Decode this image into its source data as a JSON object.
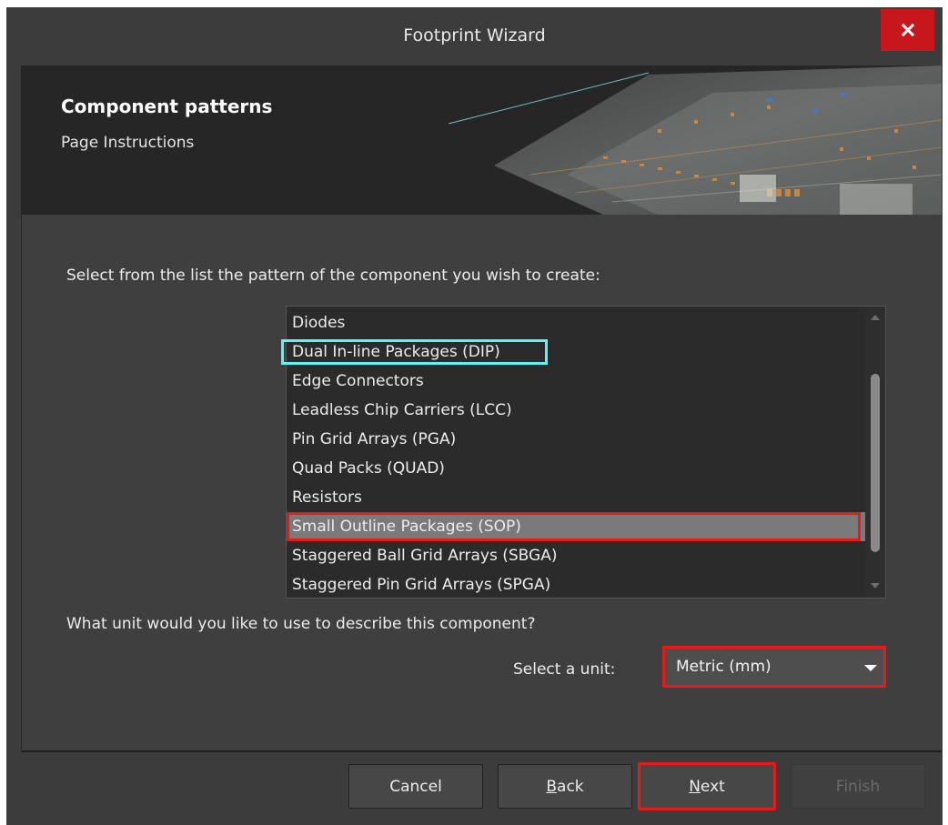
{
  "window": {
    "title": "Footprint Wizard",
    "close_icon": "close-icon"
  },
  "banner": {
    "title": "Component patterns",
    "subtitle": "Page Instructions"
  },
  "pattern_prompt": "Select from the list the pattern of the component you wish to create:",
  "patterns": {
    "items": [
      "Diodes",
      "Dual In-line Packages (DIP)",
      "Edge Connectors",
      "Leadless Chip Carriers (LCC)",
      "Pin Grid Arrays (PGA)",
      "Quad Packs (QUAD)",
      "Resistors",
      "Small Outline Packages (SOP)",
      "Staggered Ball Grid Arrays (SBGA)",
      "Staggered Pin Grid Arrays (SPGA)"
    ],
    "selected": "Small Outline Packages (SOP)"
  },
  "unit_prompt": "What unit would you like to use to describe this component?",
  "unit": {
    "label": "Select a unit:",
    "value": "Metric (mm)"
  },
  "buttons": {
    "cancel": "Cancel",
    "back_mnemonic": "B",
    "back_rest": "ack",
    "next_mnemonic": "N",
    "next_rest": "ext",
    "finish": "Finish"
  },
  "colors": {
    "selection": "#7a7a7a",
    "highlight_red": "#e8181b",
    "highlight_cyan": "#66f0f2",
    "close_button": "#c8161d"
  }
}
